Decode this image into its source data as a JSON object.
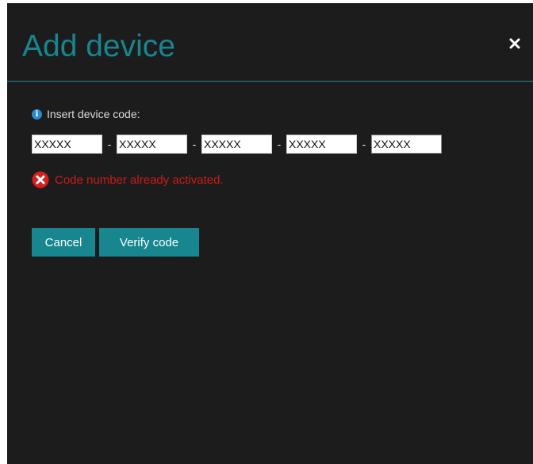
{
  "dialog": {
    "title": "Add device",
    "close_icon": "close-icon",
    "prompt": {
      "icon": "info-icon",
      "label": "Insert device code:"
    },
    "code_fields": [
      {
        "value": "XXXXX"
      },
      {
        "value": "XXXXX"
      },
      {
        "value": "XXXXX"
      },
      {
        "value": "XXXXX"
      },
      {
        "value": "XXXXX"
      }
    ],
    "separator": "-",
    "error": {
      "icon": "error-icon",
      "message": "Code number already activated."
    },
    "buttons": {
      "cancel_label": "Cancel",
      "verify_label": "Verify code"
    }
  },
  "colors": {
    "accent": "#17868f",
    "error": "#cc1b1b",
    "background": "#1c1c1c",
    "info": "#2b8ad1"
  }
}
